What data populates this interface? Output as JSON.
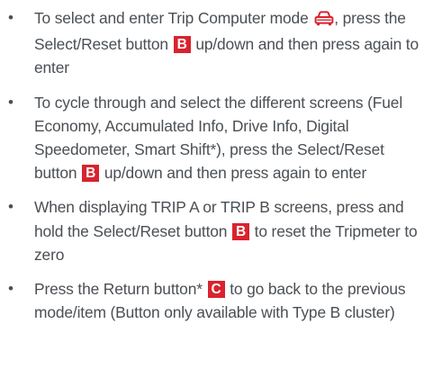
{
  "colors": {
    "text": "#4a4f54",
    "badge_bg": "#d9232e",
    "badge_text": "#ffffff",
    "icon": "#d9232e"
  },
  "bullet_glyph": "•",
  "items": [
    {
      "text_before": "To select and enter Trip Computer mode",
      "icon": "car-icon",
      "text_mid": ", press the Select/Reset button",
      "badge": "B",
      "text_after": " up/down and then press again to enter"
    },
    {
      "text_before": "To cycle through and select the different screens (Fuel Economy, Accumulated Info, Drive Info, Digital Speedometer, Smart Shift*), press the Select/Reset button",
      "badge": "B",
      "text_after": " up/down and then press again to enter"
    },
    {
      "text_before": "When displaying TRIP A or TRIP B screens, press and hold the Select/Reset button",
      "badge": "B",
      "text_after": " to reset the Tripmeter to zero"
    },
    {
      "text_before": "Press the Return button*",
      "badge": "C",
      "text_after": " to go back to the previous mode/item (Button only available with Type B cluster)"
    }
  ]
}
